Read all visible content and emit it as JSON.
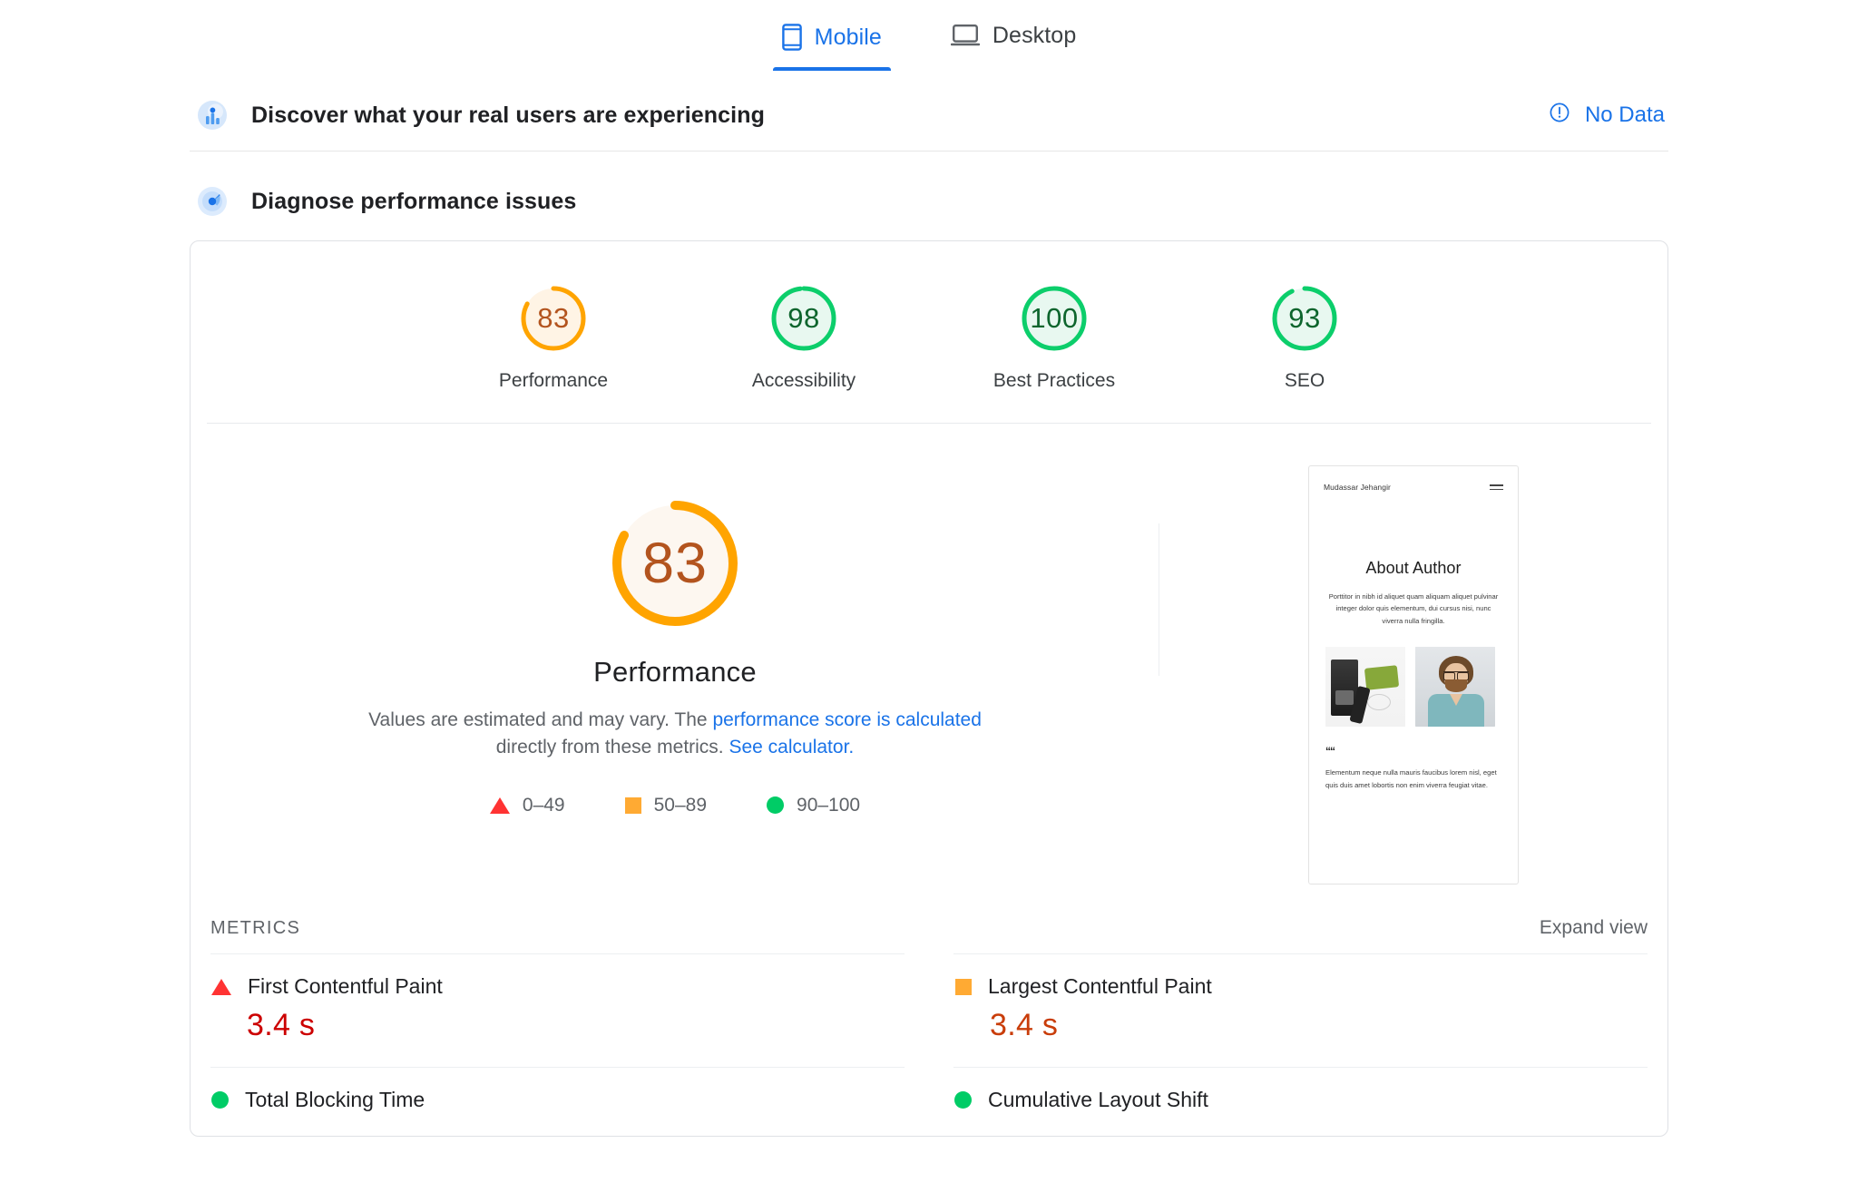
{
  "tabs": [
    {
      "label": "Mobile",
      "icon": "mobile-icon",
      "active": true
    },
    {
      "label": "Desktop",
      "icon": "desktop-icon",
      "active": false
    }
  ],
  "field_section": {
    "title": "Discover what your real users are experiencing",
    "icon": "field-data-icon",
    "status_label": "No Data",
    "status_icon": "info-icon",
    "status_color": "#1a73e8"
  },
  "lab_section": {
    "title": "Diagnose performance issues",
    "icon": "diagnose-icon"
  },
  "category_scores": [
    {
      "label": "Performance",
      "value": "83",
      "percent": 83,
      "color": "#ffa400",
      "track": "#fff4e5",
      "text_color": "#b3541e"
    },
    {
      "label": "Accessibility",
      "value": "98",
      "percent": 98,
      "color": "#0cce6b",
      "track": "#e8f8f0",
      "text_color": "#0d652d"
    },
    {
      "label": "Best Practices",
      "value": "100",
      "percent": 100,
      "color": "#0cce6b",
      "track": "#e8f8f0",
      "text_color": "#0d652d"
    },
    {
      "label": "SEO",
      "value": "93",
      "percent": 93,
      "color": "#0cce6b",
      "track": "#e8f8f0",
      "text_color": "#0d652d"
    }
  ],
  "hero": {
    "score": "83",
    "percent": 83,
    "title": "Performance",
    "desc_part1": "Values are estimated and may vary. The ",
    "desc_link1": "performance score is calculated",
    "desc_part2": " directly from these metrics. ",
    "desc_link2": "See calculator.",
    "legend": [
      {
        "shape": "triangle",
        "range": "0–49",
        "color": "#ff3333"
      },
      {
        "shape": "square",
        "range": "50–89",
        "color": "#ffaa33"
      },
      {
        "shape": "circle",
        "range": "90–100",
        "color": "#00cc66"
      }
    ]
  },
  "thumbnail": {
    "brand": "Mudassar Jehangir",
    "menu_icon": "hamburger-icon",
    "heading": "About Author",
    "body": "Porttitor in nibh id aliquet quam aliquam aliquet pulvinar integer dolor quis elementum, dui cursus nisi, nunc viverra nulla fringilla.",
    "quote_mark": "““",
    "quote_text": "Elementum neque nulla mauris faucibus lorem nisl, eget quis duis amet lobortis non enim viverra feugiat vitae.",
    "image_left_alt": "camera-gear-photo",
    "image_right_alt": "author-portrait-photo"
  },
  "metrics_section": {
    "title": "METRICS",
    "expand_label": "Expand view",
    "items": [
      {
        "name": "First Contentful Paint",
        "value": "3.4 s",
        "shape": "triangle",
        "color": "#ff3333",
        "value_color": "#cc0000"
      },
      {
        "name": "Largest Contentful Paint",
        "value": "3.4 s",
        "shape": "square",
        "color": "#ffaa33",
        "value_color": "#c93d0a"
      },
      {
        "name": "Total Blocking Time",
        "value": "",
        "shape": "circle",
        "color": "#00cc66",
        "value_color": "#0d652d"
      },
      {
        "name": "Cumulative Layout Shift",
        "value": "",
        "shape": "circle",
        "color": "#00cc66",
        "value_color": "#0d652d"
      }
    ]
  }
}
